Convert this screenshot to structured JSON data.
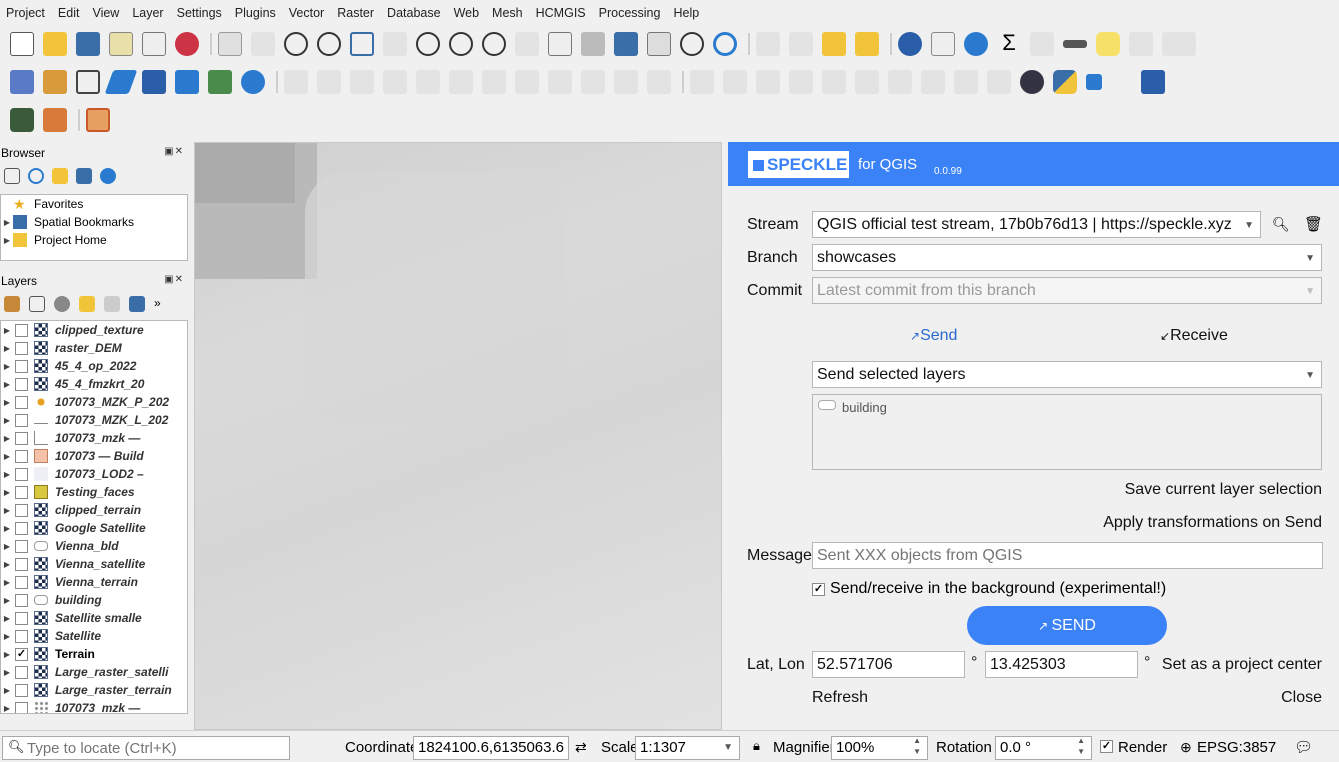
{
  "menu": [
    "Project",
    "Edit",
    "View",
    "Layer",
    "Settings",
    "Plugins",
    "Vector",
    "Raster",
    "Database",
    "Web",
    "Mesh",
    "HCMGIS",
    "Processing",
    "Help"
  ],
  "browser": {
    "title": "Browser",
    "items": [
      {
        "label": "Favorites"
      },
      {
        "label": "Spatial Bookmarks"
      },
      {
        "label": "Project Home"
      }
    ]
  },
  "layers": {
    "title": "Layers",
    "items": [
      {
        "label": "clipped_texture",
        "type": "raster",
        "checked": false
      },
      {
        "label": "raster_DEM",
        "type": "raster",
        "checked": false
      },
      {
        "label": "45_4_op_2022",
        "type": "raster",
        "checked": false
      },
      {
        "label": "45_4_fmzkrt_20",
        "type": "raster",
        "checked": false
      },
      {
        "label": "107073_MZK_P_202",
        "type": "point",
        "checked": false
      },
      {
        "label": "107073_MZK_L_202",
        "type": "line",
        "checked": false
      },
      {
        "label": "107073_mzk —",
        "type": "multi",
        "checked": false
      },
      {
        "label": "107073 — Build",
        "type": "fill",
        "checked": false
      },
      {
        "label": "107073_LOD2 –",
        "type": "fill2",
        "checked": false
      },
      {
        "label": "Testing_faces",
        "type": "yellow",
        "checked": false
      },
      {
        "label": "clipped_terrain",
        "type": "raster",
        "checked": false
      },
      {
        "label": "Google Satellite",
        "type": "raster",
        "checked": false
      },
      {
        "label": "Vienna_bld",
        "type": "poly",
        "checked": false
      },
      {
        "label": "Vienna_satellite",
        "type": "raster",
        "checked": false
      },
      {
        "label": "Vienna_terrain",
        "type": "raster",
        "checked": false
      },
      {
        "label": "building",
        "type": "poly",
        "checked": false
      },
      {
        "label": "Satellite smalle",
        "type": "raster",
        "checked": false
      },
      {
        "label": "Satellite",
        "type": "raster",
        "checked": false
      },
      {
        "label": "Terrain",
        "type": "raster",
        "checked": true
      },
      {
        "label": "Large_raster_satelli",
        "type": "raster",
        "checked": false
      },
      {
        "label": "Large_raster_terrain",
        "type": "raster",
        "checked": false
      },
      {
        "label": "107073_mzk —",
        "type": "dots",
        "checked": false
      }
    ]
  },
  "speckle": {
    "logo": "SPECKLE",
    "for": "for QGIS",
    "version": "0.0.99",
    "stream_label": "Stream",
    "stream_value": "QGIS official test stream, 17b0b76d13 | https://speckle.xyz",
    "branch_label": "Branch",
    "branch_value": "showcases",
    "commit_label": "Commit",
    "commit_placeholder": "Latest commit from this branch",
    "send_tab": "Send",
    "receive_tab": "Receive",
    "send_mode": "Send selected layers",
    "selected_layer": "building",
    "save_selection": "Save current layer selection",
    "apply_transformations": "Apply transformations on Send",
    "message_label": "Message",
    "message_placeholder": "Sent XXX objects from QGIS",
    "background_label": "Send/receive in the background (experimental!)",
    "send_button": "SEND",
    "latlon_label": "Lat, Lon",
    "lat": "52.571706",
    "lon": "13.425303",
    "degree": "°",
    "set_center": "Set as a project center",
    "refresh": "Refresh",
    "close": "Close",
    "accent": "#3b82f6"
  },
  "status": {
    "locate_placeholder": "Type to locate (Ctrl+K)",
    "coordinate_label": "Coordinate",
    "coordinate": "1824100.6,6135063.6",
    "scale_label": "Scale",
    "scale": "1:1307",
    "magnifier_label": "Magnifier",
    "magnifier": "100%",
    "rotation_label": "Rotation",
    "rotation": "0.0 °",
    "render_label": "Render",
    "crs": "EPSG:3857"
  }
}
